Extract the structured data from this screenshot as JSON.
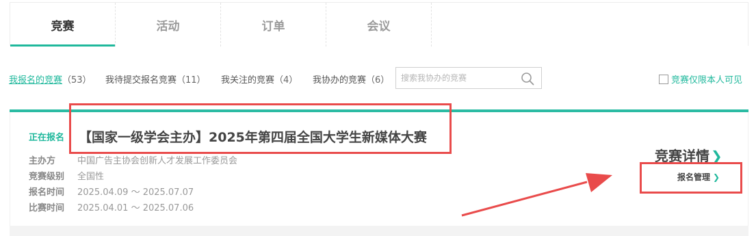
{
  "tabs": [
    {
      "label": "竞赛",
      "active": true
    },
    {
      "label": "活动",
      "active": false
    },
    {
      "label": "订单",
      "active": false
    },
    {
      "label": "会议",
      "active": false
    }
  ],
  "filters": [
    {
      "label": "我报名的竞赛",
      "count": "（53）",
      "active": true
    },
    {
      "label": "我待提交报名竞赛",
      "count": "（11）",
      "active": false
    },
    {
      "label": "我关注的竞赛",
      "count": "（4）",
      "active": false
    },
    {
      "label": "我协办的竞赛",
      "count": "（6）",
      "active": false
    }
  ],
  "search": {
    "placeholder": "搜索我协办的竞赛",
    "value": ""
  },
  "only_me_label": "竞赛仅限本人可见",
  "card": {
    "status": "正在报名",
    "title": "【国家一级学会主办】2025年第四届全国大学生新媒体大赛",
    "organizer_key": "主办方",
    "organizer": "中国广告主协会创新人才发展工作委员会",
    "level_key": "竞赛级别",
    "level": "全国性",
    "signup_key": "报名时间",
    "signup": "2025.04.09 ～ 2025.07.07",
    "match_key": "比赛时间",
    "match": "2025.04.01 ～ 2025.07.06",
    "detail_label": "竞赛详情",
    "manage_label": "报名管理"
  },
  "colors": {
    "accent": "#1fb89c",
    "annotation": "#e94b4b"
  },
  "icons": {
    "search": "search-icon",
    "chevron": "chevron-right-icon",
    "checkbox": "checkbox-icon"
  }
}
